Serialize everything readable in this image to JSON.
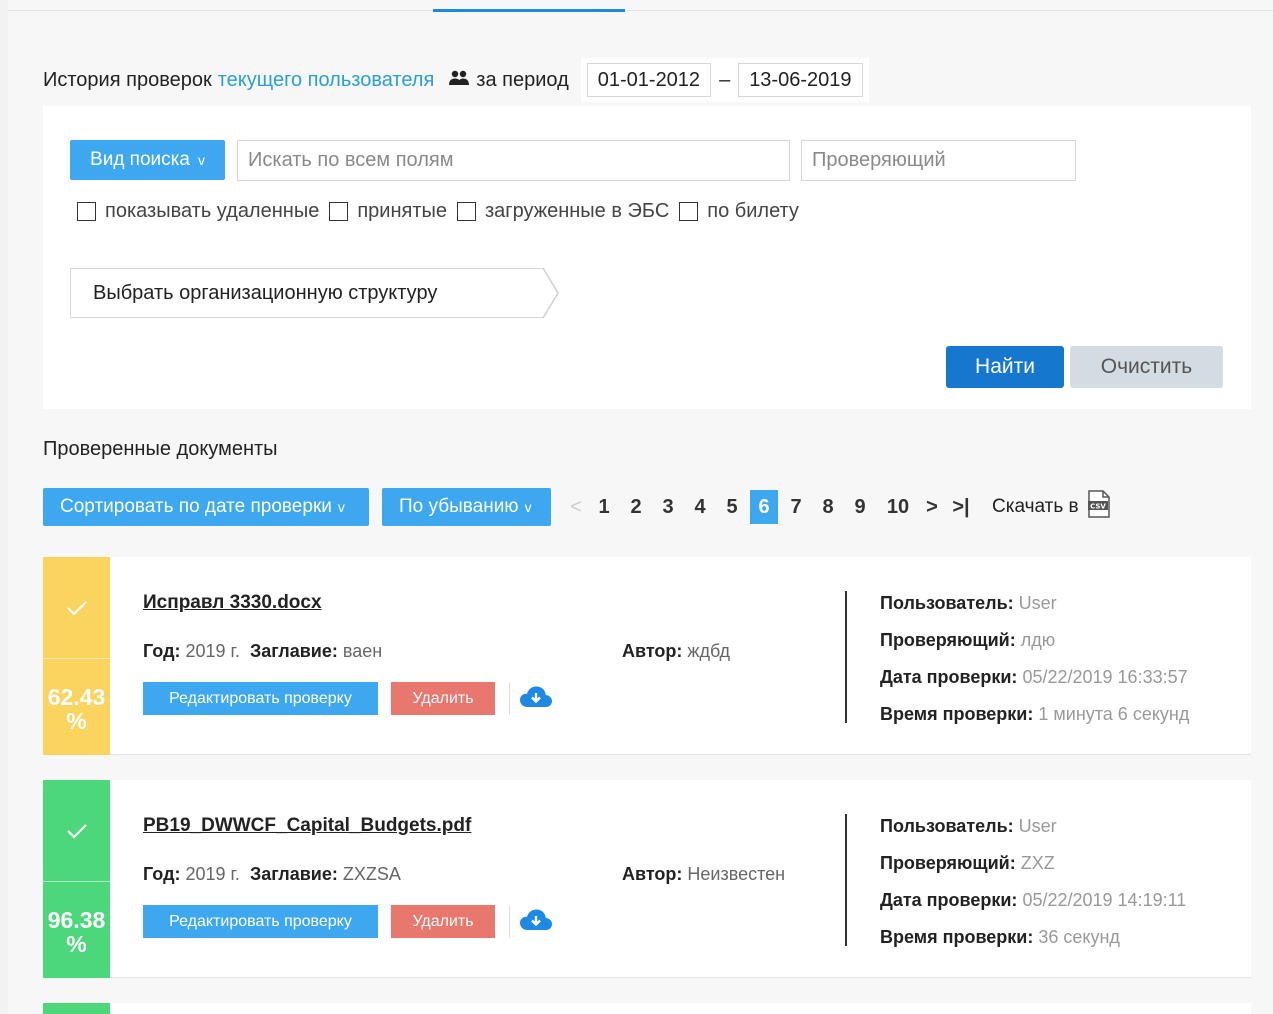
{
  "history": {
    "prefix": "История проверок",
    "link": "текущего пользователя",
    "period_label": "за период",
    "date_from": "01-01-2012",
    "dash": "–",
    "date_to": "13-06-2019"
  },
  "filters": {
    "search_type_label": "Вид поиска",
    "search_type_chevron": "v",
    "search_all_placeholder": "Искать по всем полям",
    "checker_placeholder": "Проверяющий",
    "checkboxes": [
      {
        "label": "показывать удаленные",
        "checked": false
      },
      {
        "label": "принятые",
        "checked": false
      },
      {
        "label": "загруженные в ЭБС",
        "checked": false
      },
      {
        "label": "по билету",
        "checked": false
      }
    ],
    "org_structure_label": "Выбрать организационную структуру",
    "find_label": "Найти",
    "clear_label": "Очистить"
  },
  "documents": {
    "section_title": "Проверенные документы",
    "sort_label": "Сортировать по дате проверки",
    "order_label": "По убыванию",
    "chevron": "v",
    "pager": {
      "prev": "<",
      "pages": [
        "1",
        "2",
        "3",
        "4",
        "5",
        "6",
        "7",
        "8",
        "9",
        "10"
      ],
      "current": "6",
      "next": ">",
      "last": ">|"
    },
    "download_label": "Скачать в",
    "download_format_icon": "csv-file-icon",
    "items": [
      {
        "title": "Исправл 3330.docx",
        "year_label": "Год:",
        "year": "2019 г.",
        "caption_label": "Заглавие:",
        "caption": "ваен",
        "author_label": "Автор:",
        "author": "ждбд",
        "score": "62.43",
        "percent_sign": "%",
        "color": "#fbd35f",
        "edit_label": "Редактировать проверку",
        "delete_label": "Удалить",
        "user_label": "Пользователь:",
        "user": "User",
        "checker_label": "Проверяющий:",
        "checker": "лдю",
        "date_label": "Дата проверки:",
        "date": "05/22/2019 16:33:57",
        "time_label": "Время проверки:",
        "time": "1 минута 6 секунд"
      },
      {
        "title": "PB19_DWWCF_Capital_Budgets.pdf",
        "year_label": "Год:",
        "year": "2019 г.",
        "caption_label": "Заглавие:",
        "caption": "ZXZSA",
        "author_label": "Автор:",
        "author": "Неизвестен",
        "score": "96.38",
        "percent_sign": "%",
        "color": "#4cd77a",
        "edit_label": "Редактировать проверку",
        "delete_label": "Удалить",
        "user_label": "Пользователь:",
        "user": "User",
        "checker_label": "Проверяющий:",
        "checker": "ZXZ",
        "date_label": "Дата проверки:",
        "date": "05/22/2019 14:19:11",
        "time_label": "Время проверки:",
        "time": "36 секунд"
      }
    ]
  },
  "colors": {
    "accent": "#3da8f0",
    "primary": "#1677cf",
    "danger": "#e8776d",
    "link": "#2a9fd6",
    "partial_card_color": "#4cd77a"
  }
}
